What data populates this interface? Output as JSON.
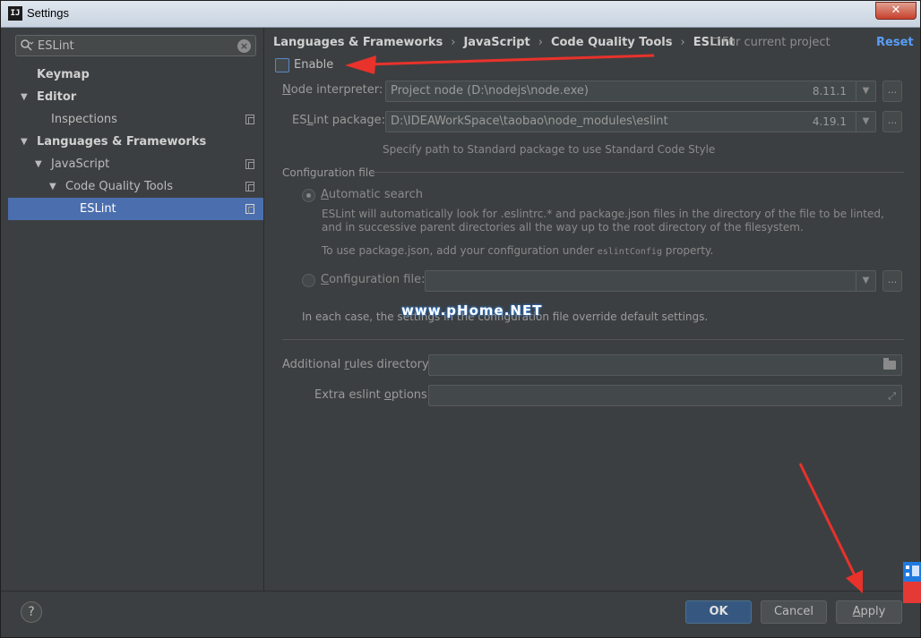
{
  "window": {
    "title": "Settings",
    "app_icon_text": "IJ",
    "close_glyph": "✕"
  },
  "search": {
    "value": "ESLint",
    "placeholder": ""
  },
  "tree": [
    {
      "label": "Keymap",
      "bold": true,
      "level": 0,
      "expanded": null,
      "selected": false,
      "has_copy_icon": false
    },
    {
      "label": "Editor",
      "bold": true,
      "level": 0,
      "expanded": true,
      "selected": false,
      "has_copy_icon": false
    },
    {
      "label": "Inspections",
      "bold": false,
      "level": 1,
      "expanded": null,
      "selected": false,
      "has_copy_icon": true
    },
    {
      "label": "Languages & Frameworks",
      "bold": true,
      "level": 0,
      "expanded": true,
      "selected": false,
      "has_copy_icon": false
    },
    {
      "label": "JavaScript",
      "bold": false,
      "level": 1,
      "expanded": true,
      "selected": false,
      "has_copy_icon": true
    },
    {
      "label": "Code Quality Tools",
      "bold": false,
      "level": 2,
      "expanded": true,
      "selected": false,
      "has_copy_icon": true
    },
    {
      "label": "ESLint",
      "bold": false,
      "level": 3,
      "expanded": null,
      "selected": true,
      "has_copy_icon": true
    }
  ],
  "breadcrumb": [
    "Languages & Frameworks",
    "JavaScript",
    "Code Quality Tools",
    "ESLint"
  ],
  "breadcrumb_separator": "›",
  "for_current_project": "For current project",
  "reset_label": "Reset",
  "enable": {
    "label": "Enable",
    "checked": false
  },
  "node_interpreter": {
    "label_prefix": "N",
    "label_rest": "ode interpreter:",
    "value": "Project  node (D:\\nodejs\\node.exe)",
    "version": "8.11.1"
  },
  "eslint_package": {
    "label_prefix": "ES",
    "label_u": "L",
    "label_rest": "int package:",
    "value": "D:\\IDEAWorkSpace\\taobao\\node_modules\\eslint",
    "version": "4.19.1"
  },
  "package_hint": "Specify path to Standard package to use Standard Code Style",
  "configuration_file_group": "Configuration file",
  "automatic_search": {
    "label_u": "A",
    "label_rest": "utomatic search",
    "selected": true
  },
  "automatic_desc_1": "ESLint will automatically look for .eslintrc.* and package.json files in the directory of the file to be linted, and in successive parent directories all the way up to the root directory of the filesystem.",
  "automatic_desc_2_pre": "To use package.json, add your configuration under ",
  "automatic_desc_2_code": "eslintConfig",
  "automatic_desc_2_post": " property.",
  "configuration_file_option": {
    "label_u": "C",
    "label_rest": "onfiguration file:",
    "selected": false,
    "value": ""
  },
  "each_case_note": "In each case, the settings in the configuration file override default settings.",
  "watermark": "www.pHome.NET",
  "additional_rules": {
    "label_pre": "Additional ",
    "label_u": "r",
    "label_rest": "ules directory:",
    "value": ""
  },
  "extra_options": {
    "label_pre": "Extra eslint ",
    "label_u": "o",
    "label_rest": "ptions:",
    "value": ""
  },
  "buttons": {
    "ok": "OK",
    "cancel": "Cancel",
    "apply_u": "A",
    "apply_rest": "pply",
    "help": "?",
    "ellipsis": "..."
  },
  "colors": {
    "background": "#3c3f41",
    "selection": "#4b6eaf",
    "link": "#589df6",
    "annotation_arrow": "#e8322b"
  }
}
